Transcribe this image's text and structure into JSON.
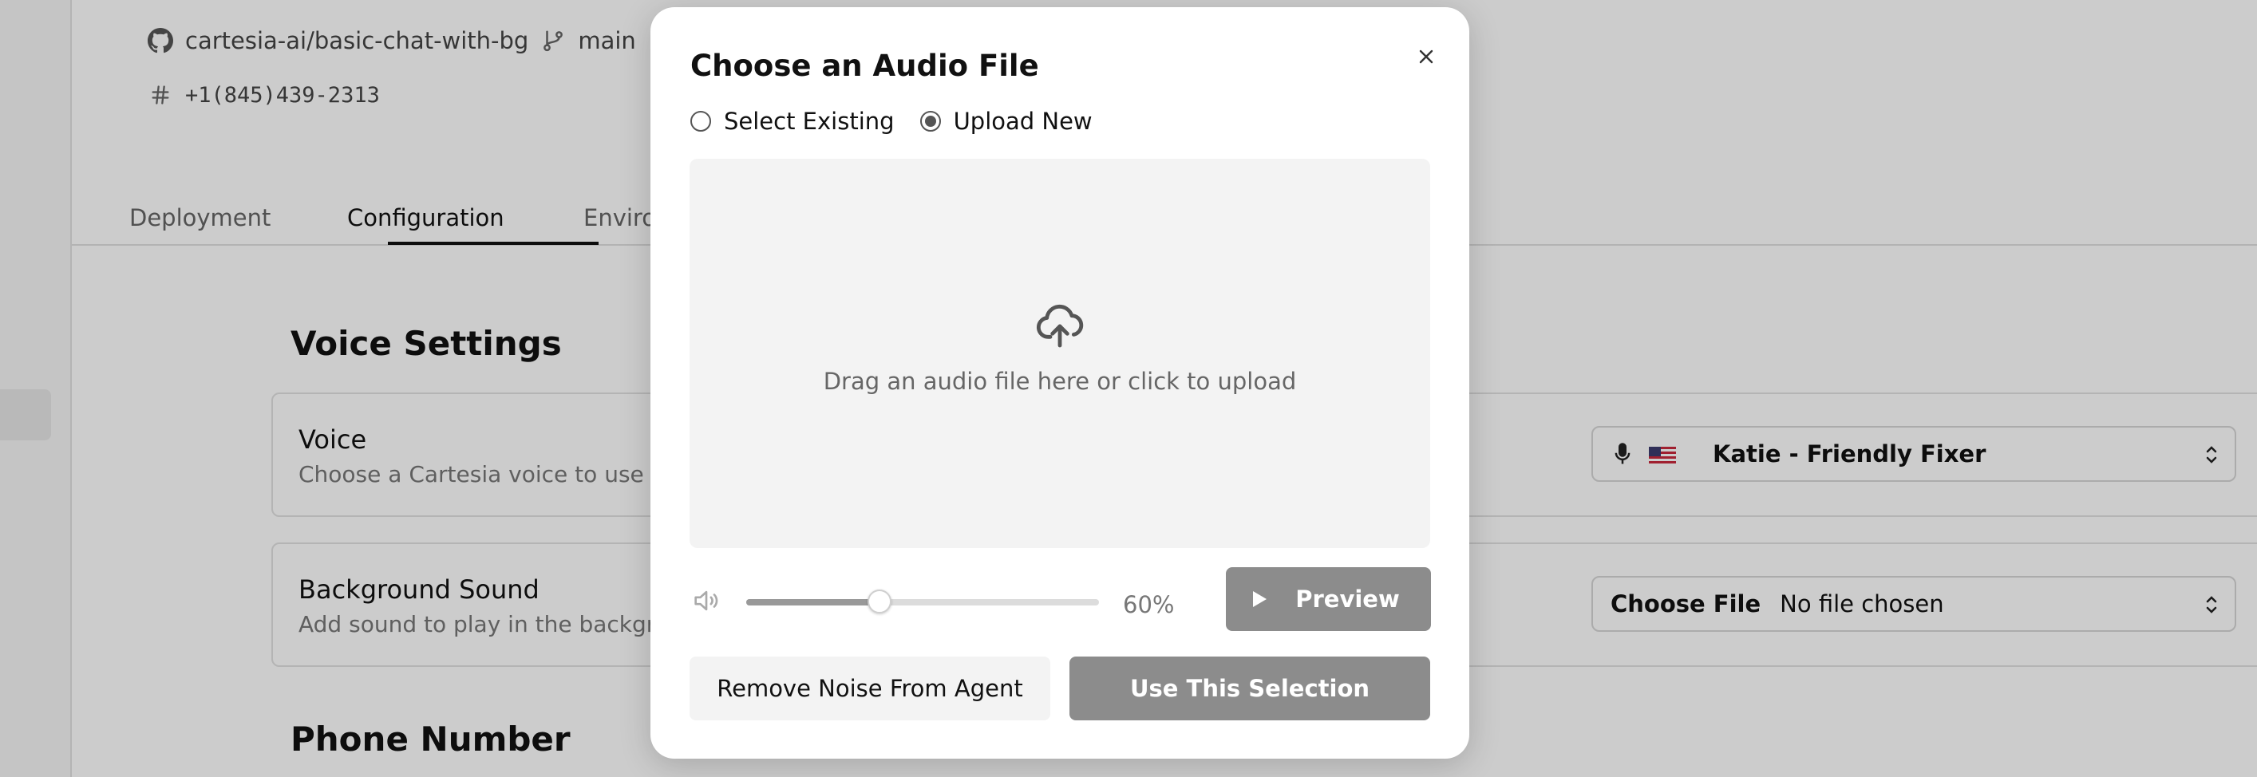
{
  "header": {
    "repo": "cartesia-ai/basic-chat-with-bg",
    "branch": "main",
    "phone": "+1(845)439-2313"
  },
  "tabs": [
    {
      "label": "Deployment"
    },
    {
      "label": "Configuration",
      "active": true
    },
    {
      "label": "Enviro"
    }
  ],
  "voice_settings": {
    "title": "Voice Settings",
    "voice": {
      "title": "Voice",
      "description": "Choose a Cartesia voice to use w",
      "selected": "Katie - Friendly Fixer"
    },
    "background_sound": {
      "title": "Background Sound",
      "description": "Add sound to play in the backgro",
      "choose_file_label": "Choose File",
      "file_status": "No file chosen"
    }
  },
  "phone_section": {
    "title": "Phone Number"
  },
  "modal": {
    "title": "Choose an Audio File",
    "options": [
      {
        "label": "Select Existing",
        "checked": false
      },
      {
        "label": "Upload New",
        "checked": true
      }
    ],
    "dropzone_text": "Drag an audio file here or click to upload",
    "volume": {
      "value": 60,
      "label": "60%"
    },
    "preview_label": "Preview",
    "remove_noise_label": "Remove Noise From Agent",
    "use_selection_label": "Use This Selection"
  },
  "icons": {
    "repo": "github-icon",
    "branch": "git-branch-icon",
    "phone": "hash-icon",
    "close": "close-icon",
    "upload": "cloud-upload-icon",
    "volume": "volume-icon",
    "play": "play-icon",
    "mic": "microphone-icon",
    "flag": "us-flag-icon"
  }
}
